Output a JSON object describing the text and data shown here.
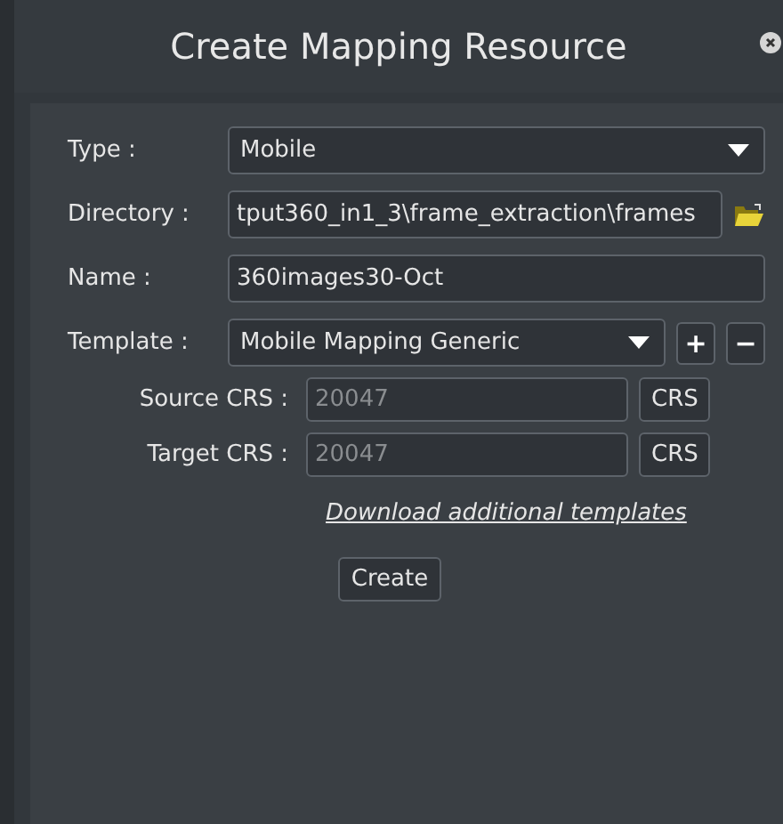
{
  "window": {
    "title": "Create Mapping Resource"
  },
  "form": {
    "type": {
      "label": "Type :",
      "value": "Mobile"
    },
    "directory": {
      "label": "Directory :",
      "value": "tput360_in1_3\\frame_extraction\\frames"
    },
    "name": {
      "label": "Name :",
      "value": "360images30-Oct"
    },
    "template": {
      "label": "Template :",
      "value": "Mobile Mapping Generic",
      "add": "+",
      "remove": "−"
    },
    "crs": [
      {
        "label": "Source CRS :",
        "placeholder": "20047",
        "button": "CRS"
      },
      {
        "label": "Target CRS :",
        "placeholder": "20047",
        "button": "CRS"
      }
    ],
    "link": "Download additional templates",
    "submit": "Create"
  }
}
